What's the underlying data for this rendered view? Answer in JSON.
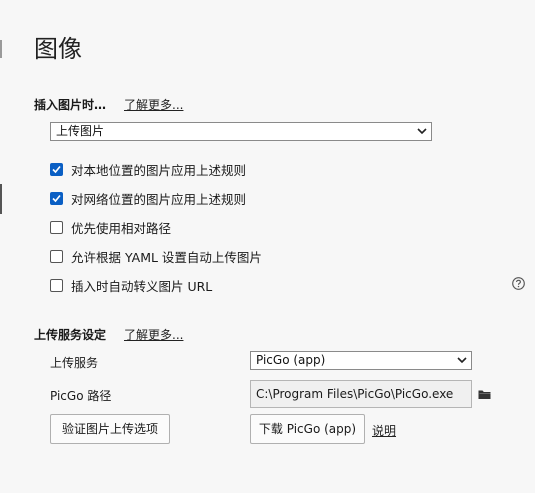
{
  "page": {
    "title": "图像"
  },
  "insert": {
    "heading": "插入图片时…",
    "learn_more": "了解更多...",
    "action_select": "上传图片",
    "options": [
      {
        "label": "对本地位置的图片应用上述规则",
        "checked": true
      },
      {
        "label": "对网络位置的图片应用上述规则",
        "checked": true
      },
      {
        "label": "优先使用相对路径",
        "checked": false
      },
      {
        "label": "允许根据 YAML 设置自动上传图片",
        "checked": false
      },
      {
        "label": "插入时自动转义图片 URL",
        "checked": false
      }
    ]
  },
  "upload": {
    "heading": "上传服务设定",
    "learn_more": "了解更多...",
    "service_label": "上传服务",
    "service_value": "PicGo (app)",
    "path_label": "PicGo 路径",
    "path_value": "C:\\Program Files\\PicGo\\PicGo.exe",
    "verify_button": "验证图片上传选项",
    "download_button": "下载 PicGo (app)",
    "explain_link": "说明"
  },
  "icons": {
    "folder": "folder-icon",
    "help": "help-circle-icon",
    "chevron": "chevron-down-icon"
  },
  "colors": {
    "checkbox_checked": "#0a5fc4",
    "background": "#f7f7f7"
  }
}
